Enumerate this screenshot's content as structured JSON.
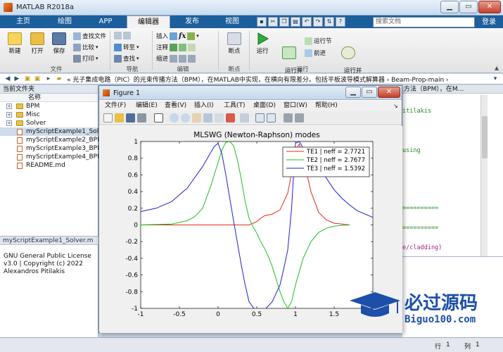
{
  "window": {
    "title": "MATLAB R2018a"
  },
  "ribbon_tabs": [
    "主页",
    "绘图",
    "APP",
    "编辑器",
    "发布",
    "视图"
  ],
  "search": {
    "placeholder": "搜索文档"
  },
  "login_label": "登录",
  "ribbon": {
    "file": {
      "new": "新建",
      "open": "打开",
      "save": "保存",
      "find_files": "查找文件",
      "compare": "比较",
      "print": "打印",
      "group": "文件"
    },
    "nav": {
      "goto": "转至",
      "find": "查找",
      "group": "导航"
    },
    "edit": {
      "insert": "插入",
      "comment": "注释",
      "indent": "缩进",
      "fx": "fx",
      "group": "编辑"
    },
    "breakpoints": {
      "label": "断点",
      "group": "断点"
    },
    "run": {
      "run": "运行",
      "run_advance": "运行并\n前进",
      "run_section": "运行节",
      "advance": "前进",
      "run_time": "运行并\n计时",
      "group": "运行"
    }
  },
  "address": {
    "path": "«  光子集成电路（PIC）的光束传播方法（BPM），在MATLAB中实现，在横向有限差分。包括平板波导模式解算器  ›  Beam-Prop-main  ›"
  },
  "file_panel": {
    "header": "当前文件夹",
    "column": "名称",
    "items": [
      {
        "name": "BPM",
        "type": "folder"
      },
      {
        "name": "Misc",
        "type": "folder"
      },
      {
        "name": "Solver",
        "type": "folder"
      },
      {
        "name": "myScriptExample1_Solver.m",
        "type": "file",
        "selected": true
      },
      {
        "name": "myScriptExample2_BPM.m",
        "type": "file"
      },
      {
        "name": "myScriptExample3_BPM.m",
        "type": "file"
      },
      {
        "name": "myScriptExample4_BPM.m",
        "type": "file"
      },
      {
        "name": "README.md",
        "type": "file"
      }
    ],
    "detail_header": "myScriptExample1_Solver.m",
    "detail_lines": [
      "GNU General Public License",
      "v3.0 | Copyright (c) 2022",
      "Alexandros Pitilakis"
    ]
  },
  "editor": {
    "header": "方法（BPM），在M...",
    "lines": [
      {
        "text": "itilakis",
        "style": "green"
      },
      {
        "text": "using",
        "style": "green"
      },
      {
        "text": "==========",
        "style": "green"
      },
      {
        "text": "==========",
        "style": "green"
      },
      {
        "text": "e/cladding)",
        "style": "purple"
      }
    ]
  },
  "status": {
    "row_label": "行",
    "row": "1",
    "col_label": "列",
    "col": "1"
  },
  "figure": {
    "title": "Figure 1",
    "menu": [
      "文件(F)",
      "编辑(E)",
      "查看(V)",
      "插入(I)",
      "工具(T)",
      "桌面(D)",
      "窗口(W)",
      "帮助(H)"
    ]
  },
  "chart_data": {
    "type": "line",
    "title": "MLSWG (Newton-Raphson) modes",
    "xlim": [
      -1,
      2
    ],
    "ylim": [
      -1,
      1
    ],
    "xticks": [
      -1,
      -0.5,
      0,
      0.5,
      1,
      1.5
    ],
    "yticks": [
      -1,
      -0.8,
      -0.6,
      -0.4,
      -0.2,
      0,
      0.2,
      0.4,
      0.6,
      0.8,
      1
    ],
    "legend_position": "top-right",
    "series": [
      {
        "name": "TE1 | neff = 2.7721",
        "color": "#e8281e",
        "x": [
          -1,
          0.4,
          0.5,
          0.55,
          0.6,
          0.7,
          0.8,
          0.9,
          0.95,
          1.0,
          1.05,
          1.1,
          1.15,
          1.2,
          1.3,
          1.4,
          1.5,
          1.6,
          1.7
        ],
        "y": [
          0,
          0,
          0.04,
          0.08,
          0.11,
          0.13,
          0.18,
          0.38,
          0.62,
          0.9,
          0.97,
          0.8,
          0.6,
          0.4,
          0.15,
          0.06,
          0.02,
          0.01,
          0
        ]
      },
      {
        "name": "TE2 | neff = 2.7677",
        "color": "#1fbf1f",
        "x": [
          -1,
          -0.8,
          -0.6,
          -0.4,
          -0.3,
          -0.2,
          -0.1,
          0,
          0.05,
          0.1,
          0.15,
          0.2,
          0.25,
          0.3,
          0.35,
          0.4,
          0.45,
          0.5,
          0.55,
          0.6,
          0.65,
          0.7,
          0.75,
          0.8,
          0.85,
          0.9,
          0.95,
          1.0,
          1.1,
          1.2,
          1.3,
          1.4,
          1.5,
          1.6,
          1.7
        ],
        "y": [
          0,
          0.005,
          0.01,
          0.05,
          0.1,
          0.2,
          0.45,
          0.75,
          0.9,
          0.99,
          1.0,
          0.95,
          0.78,
          0.55,
          0.28,
          0.08,
          -0.02,
          -0.1,
          -0.2,
          -0.28,
          -0.38,
          -0.5,
          -0.65,
          -0.8,
          -0.92,
          -1.0,
          -0.92,
          -0.72,
          -0.4,
          -0.2,
          -0.09,
          -0.04,
          -0.015,
          -0.005,
          0
        ]
      },
      {
        "name": "TE3 | neff = 1.5392",
        "color": "#1f1fd0",
        "x": [
          -1,
          -0.8,
          -0.6,
          -0.4,
          -0.2,
          -0.1,
          -0.05,
          0,
          0.05,
          0.1,
          0.2,
          0.3,
          0.35,
          0.4,
          0.5,
          0.6,
          0.7,
          0.8,
          0.85,
          0.9,
          0.95,
          1.0,
          1.05,
          1.1,
          1.2,
          1.3,
          1.4,
          1.5,
          1.6,
          1.7,
          1.8,
          2.0
        ],
        "y": [
          0.16,
          0.2,
          0.28,
          0.44,
          0.7,
          0.86,
          0.94,
          0.98,
          0.85,
          0.6,
          0.05,
          -0.48,
          -0.72,
          -0.92,
          -1.05,
          -1.02,
          -0.92,
          -0.72,
          -0.52,
          -0.3,
          0.2,
          0.98,
          1.0,
          0.92,
          0.82,
          0.7,
          0.56,
          0.42,
          0.32,
          0.24,
          0.17,
          0.09
        ]
      }
    ]
  }
}
